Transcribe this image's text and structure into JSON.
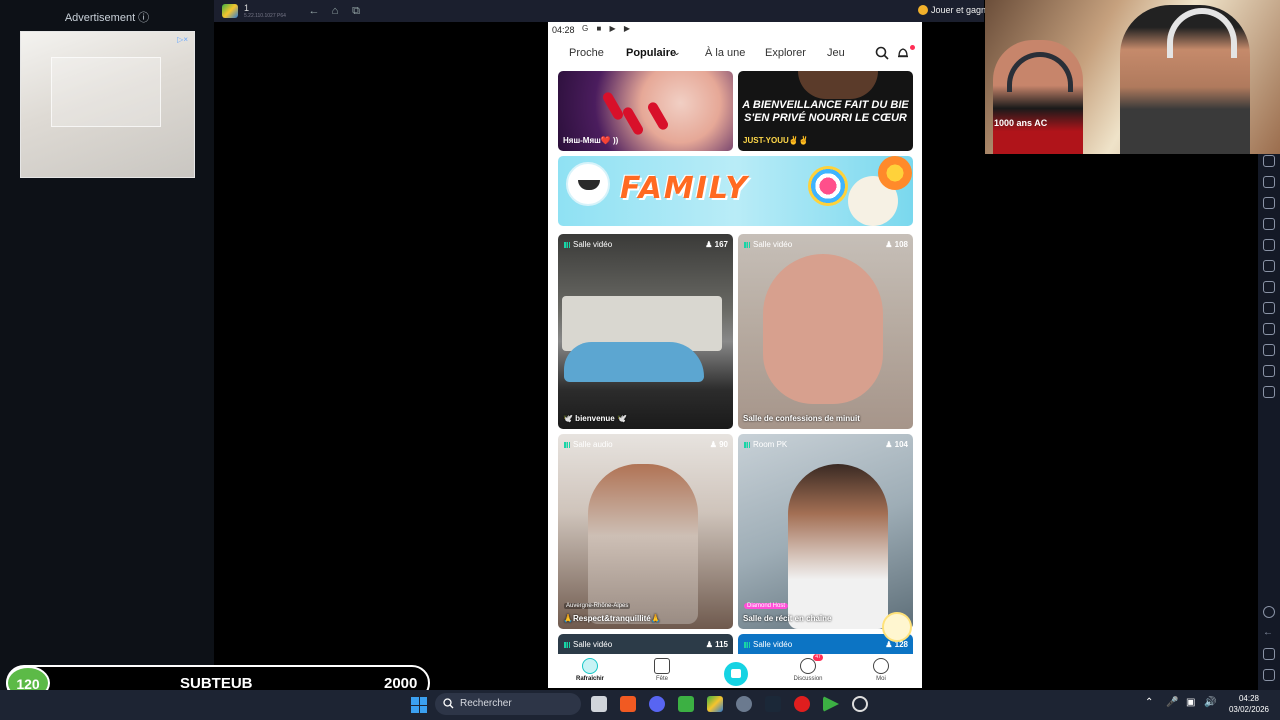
{
  "advertisement": {
    "title": "Advertisement ⓘ",
    "choice": "▷×"
  },
  "emulator": {
    "instance_number": "1",
    "version": "5.22.110.1027 P64",
    "promo_text": "Jouer et gagn"
  },
  "phone": {
    "status_time": "04:28",
    "status_icons": "G ■ ▶ ▶",
    "tabs": [
      {
        "label": "Proche",
        "active": false
      },
      {
        "label": "Populaire",
        "active": true
      },
      {
        "label": "À la une",
        "active": false
      },
      {
        "label": "Explorer",
        "active": false
      },
      {
        "label": "Jeu",
        "active": false
      }
    ],
    "top_tiles": [
      {
        "caption": "Няш-Мяш❤️ ))"
      },
      {
        "overlay": "A BIENVEILLANCE FAIT DU BIE\nS'EN PRIVÉ NOURRI LE CŒUR\nDE RIEN...",
        "caption": "JUST-YOUU✌️✌️"
      }
    ],
    "banner": {
      "title": "FAMILY"
    },
    "rooms": [
      {
        "type": "Salle vidéo",
        "count": "167",
        "title": "🕊️ bienvenue 🕊️",
        "location": "",
        "badge": ""
      },
      {
        "type": "Salle vidéo",
        "count": "108",
        "title": "Salle de confessions de minuit",
        "location": "",
        "badge": ""
      },
      {
        "type": "Salle audio",
        "count": "90",
        "title": "🙏Respect&tranquillité🙏",
        "location": "Auvergne-Rhône-Alpes",
        "badge": ""
      },
      {
        "type": "Room PK",
        "count": "104",
        "title": "Salle de récit en chaîne",
        "location": "",
        "badge": "Diamond Host"
      },
      {
        "type": "Salle vidéo",
        "count": "115",
        "title": "",
        "location": "",
        "badge": ""
      },
      {
        "type": "Salle vidéo",
        "count": "128",
        "title": "",
        "location": "",
        "badge": ""
      }
    ],
    "bottom_nav": [
      {
        "label": "Rafraîchir",
        "active": true,
        "badge": ""
      },
      {
        "label": "Fête",
        "active": false,
        "badge": ""
      },
      {
        "label": "",
        "active": false,
        "badge": ""
      },
      {
        "label": "Discussion",
        "active": false,
        "badge": "47"
      },
      {
        "label": "Moi",
        "active": false,
        "badge": ""
      }
    ]
  },
  "webcam": {
    "shirt_text": "1000 ans AC"
  },
  "subscriber_bar": {
    "count": "120",
    "label": "SUBTEUB",
    "goal": "2000"
  },
  "taskbar": {
    "search_placeholder": "Rechercher",
    "time": "04:28",
    "date": "03/02/2026"
  },
  "colors": {
    "accent": "#16d3e3",
    "notification": "#ff2d55",
    "banner_text": "#ff6a21",
    "sub_circle": "#5cba47",
    "taskbar_bg": "#1d2433"
  }
}
